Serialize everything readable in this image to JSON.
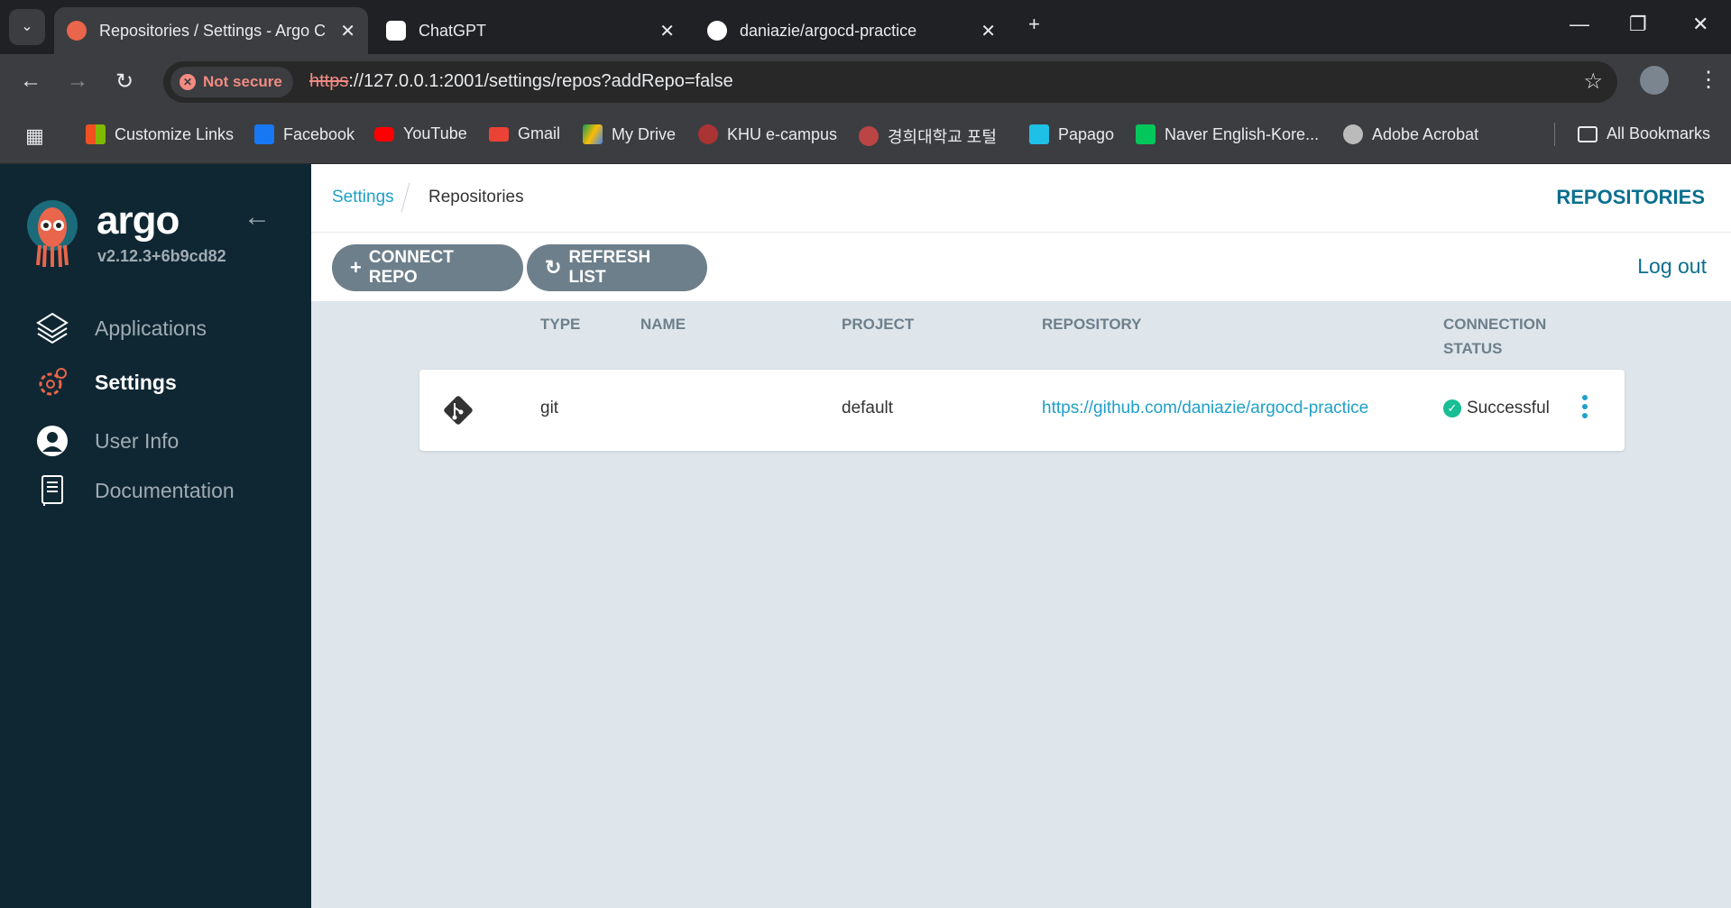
{
  "browser": {
    "tabs": [
      {
        "title": "Repositories / Settings - Argo C",
        "active": true
      },
      {
        "title": "ChatGPT",
        "active": false
      },
      {
        "title": "daniazie/argocd-practice",
        "active": false
      }
    ],
    "security_label": "Not secure",
    "url_scheme": "https",
    "url_rest": "://127.0.0.1:2001/settings/repos?addRepo=false",
    "bookmarks": [
      "Customize Links",
      "Facebook",
      "YouTube",
      "Gmail",
      "My Drive",
      "KHU e-campus",
      "경희대학교 포털",
      "Papago",
      "Naver English-Kore...",
      "Adobe Acrobat"
    ],
    "all_bookmarks": "All Bookmarks"
  },
  "sidebar": {
    "brand": "argo",
    "version": "v2.12.3+6b9cd82",
    "items": [
      {
        "label": "Applications"
      },
      {
        "label": "Settings",
        "active": true
      },
      {
        "label": "User Info"
      },
      {
        "label": "Documentation"
      }
    ]
  },
  "header": {
    "breadcrumb": [
      "Settings",
      "Repositories"
    ],
    "title": "REPOSITORIES"
  },
  "actions": {
    "connect": "CONNECT REPO",
    "refresh": "REFRESH LIST",
    "logout": "Log out"
  },
  "table": {
    "headers": {
      "type": "TYPE",
      "name": "NAME",
      "project": "PROJECT",
      "repository": "REPOSITORY",
      "status1": "CONNECTION",
      "status2": "STATUS"
    },
    "rows": [
      {
        "type": "git",
        "name": "",
        "project": "default",
        "repository": "https://github.com/daniazie/argocd-practice",
        "status": "Successful"
      }
    ]
  },
  "colors": {
    "sidebar": "#0f2733",
    "accent": "#1fa0c8",
    "button": "#6d7f8b",
    "success": "#18be94"
  }
}
